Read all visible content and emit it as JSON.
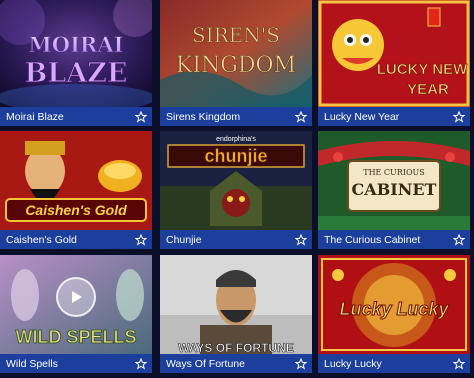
{
  "games": [
    {
      "title": "Moirai Blaze",
      "logo": "MOIRAI BLAZE"
    },
    {
      "title": "Sirens Kingdom",
      "logo": "SIREN'S KINGDOM"
    },
    {
      "title": "Lucky New Year",
      "logo": "LUCKY NEW YEAR"
    },
    {
      "title": "Caishen's Gold",
      "logo": "Caishen's Gold"
    },
    {
      "title": "Chunjie",
      "logo": "chunjie",
      "brand": "endorphina's"
    },
    {
      "title": "The Curious Cabinet",
      "logo_small": "THE CURIOUS",
      "logo": "CABINET"
    },
    {
      "title": "Wild Spells",
      "logo": "WILD SPELLS"
    },
    {
      "title": "Ways Of Fortune",
      "logo": "WAYS OF FORTUNE"
    },
    {
      "title": "Lucky Lucky",
      "logo": "Lucky Lucky"
    }
  ],
  "icons": {
    "favorite": "star-outline-icon",
    "play": "play-icon"
  },
  "colors": {
    "background": "#0b0f2a",
    "label_bar": "#1c3f9e",
    "label_text": "#ffffff"
  }
}
